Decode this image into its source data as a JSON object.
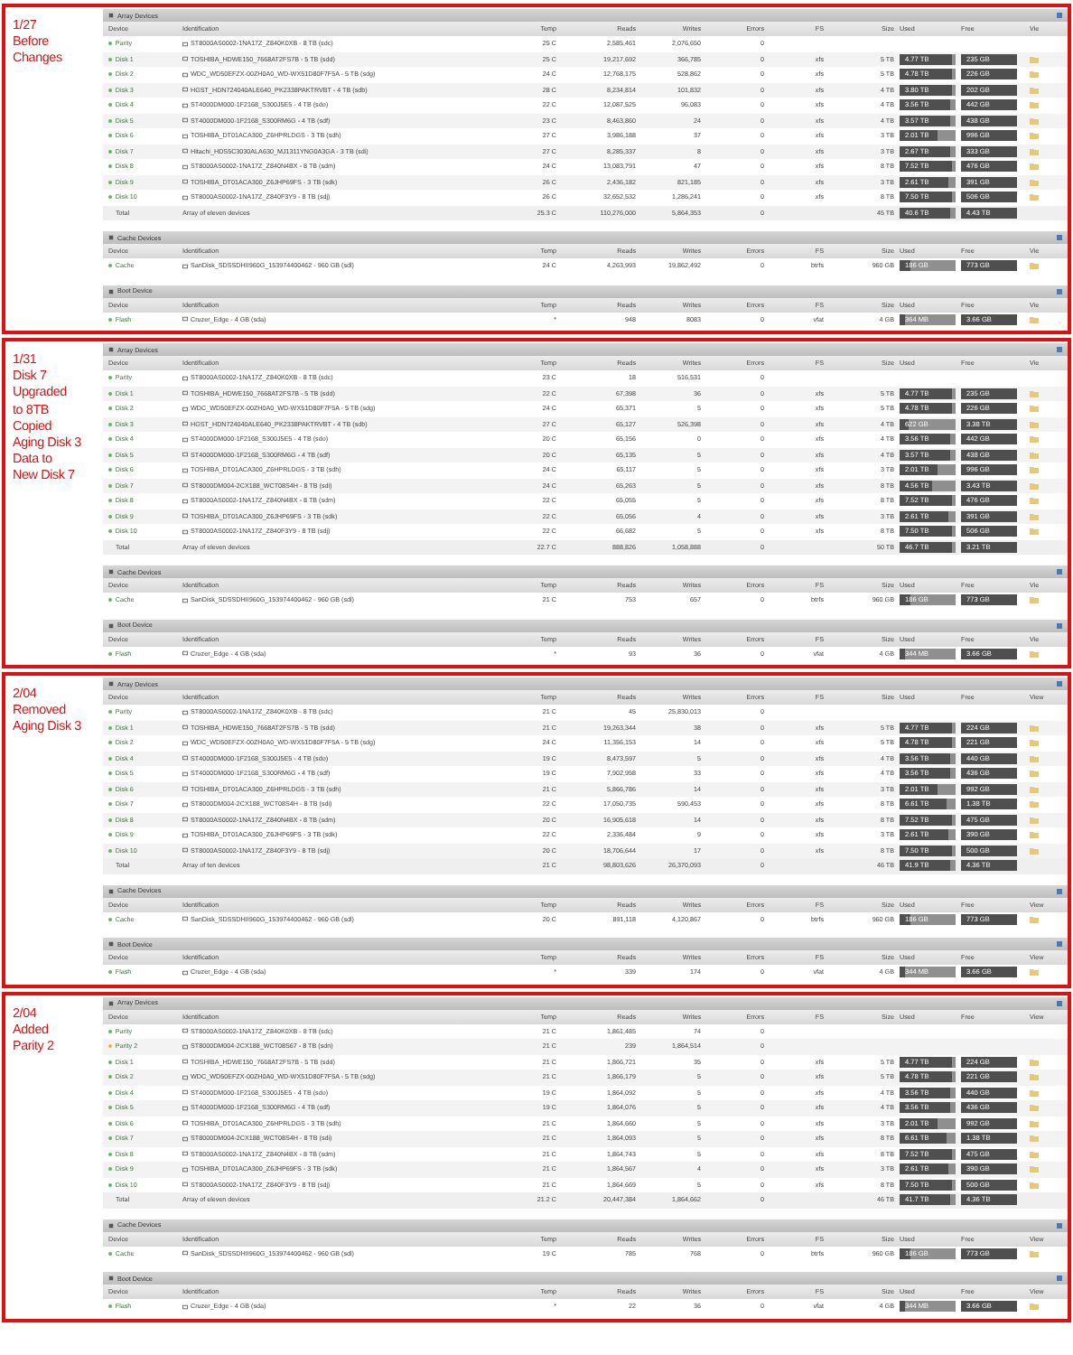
{
  "sections": [
    {
      "caption": [
        "1/27",
        "Before",
        "Changes"
      ],
      "panels": [
        {
          "title": "Array Devices",
          "columns": [
            "Device",
            "Identification",
            "Temp",
            "Reads",
            "Writes",
            "Errors",
            "FS",
            "Size",
            "Used",
            "Free",
            "Vie"
          ],
          "rows": [
            {
              "kind": "device",
              "device": "Parity",
              "color": "#5cb85c",
              "id": "ST8000AS0002-1NA17Z_Z840K0XB - 8 TB (sdc)",
              "temp": "25 C",
              "reads": "2,585,461",
              "writes": "2,076,650",
              "errors": "0"
            },
            {
              "kind": "device",
              "device": "Disk 1",
              "color": "#5cb85c",
              "id": "TOSHIBA_HDWE150_7668AT2FS7B - 5 TB (sdd)",
              "temp": "25 C",
              "reads": "19,217,692",
              "writes": "366,785",
              "errors": "0",
              "fs": "xfs",
              "size": "5 TB",
              "used": "4.77 TB",
              "free": "235 GB",
              "level": 0.95
            },
            {
              "kind": "device",
              "device": "Disk 2",
              "color": "#5cb85c",
              "id": "WDC_WD50EFZX-00ZH0A0_WD-WX51D80F7F5A - 5 TB (sdg)",
              "temp": "24 C",
              "reads": "12,768,175",
              "writes": "528,862",
              "errors": "0",
              "fs": "xfs",
              "size": "5 TB",
              "used": "4.78 TB",
              "free": "226 GB",
              "level": 0.95
            },
            {
              "kind": "device",
              "device": "Disk 3",
              "color": "#5cb85c",
              "id": "HGST_HDN724040ALE640_PK2338PAKTRVBT - 4 TB (sdb)",
              "temp": "28 C",
              "reads": "8,234,814",
              "writes": "101,832",
              "errors": "0",
              "fs": "xfs",
              "size": "4 TB",
              "used": "3.80 TB",
              "free": "202 GB",
              "level": 0.95
            },
            {
              "kind": "device",
              "device": "Disk 4",
              "color": "#5cb85c",
              "id": "ST4000DM000-1F2168_S300J5E5 - 4 TB (sdo)",
              "temp": "22 C",
              "reads": "12,087,525",
              "writes": "96,083",
              "errors": "0",
              "fs": "xfs",
              "size": "4 TB",
              "used": "3.56 TB",
              "free": "442 GB",
              "level": 0.89
            },
            {
              "kind": "device",
              "device": "Disk 5",
              "color": "#5cb85c",
              "id": "ST4000DM000-1F2168_S300RM6G - 4 TB (sdf)",
              "temp": "23 C",
              "reads": "8,463,860",
              "writes": "24",
              "errors": "0",
              "fs": "xfs",
              "size": "4 TB",
              "used": "3.57 TB",
              "free": "438 GB",
              "level": 0.89
            },
            {
              "kind": "device",
              "device": "Disk 6",
              "color": "#5cb85c",
              "id": "TOSHIBA_DT01ACA300_Z6HPRLDGS - 3 TB (sdh)",
              "temp": "27 C",
              "reads": "3,986,188",
              "writes": "37",
              "errors": "0",
              "fs": "xfs",
              "size": "3 TB",
              "used": "2.01 TB",
              "free": "996 GB",
              "level": 0.67
            },
            {
              "kind": "device",
              "device": "Disk 7",
              "color": "#5cb85c",
              "id": "Hitachi_HDS5C3030ALA630_MJ1311YNG0A3GA - 3 TB (sdi)",
              "temp": "27 C",
              "reads": "8,285,337",
              "writes": "8",
              "errors": "0",
              "fs": "xfs",
              "size": "3 TB",
              "used": "2.67 TB",
              "free": "333 GB",
              "level": 0.89
            },
            {
              "kind": "device",
              "device": "Disk 8",
              "color": "#5cb85c",
              "id": "ST8000AS0002-1NA17Z_Z840N4BX - 8 TB (sdm)",
              "temp": "24 C",
              "reads": "13,083,791",
              "writes": "47",
              "errors": "0",
              "fs": "xfs",
              "size": "8 TB",
              "used": "7.52 TB",
              "free": "476 GB",
              "level": 0.94
            },
            {
              "kind": "device",
              "device": "Disk 9",
              "color": "#5cb85c",
              "id": "TOSHIBA_DT01ACA300_Z6JHP69FS - 3 TB (sdk)",
              "temp": "26 C",
              "reads": "2,436,182",
              "writes": "821,185",
              "errors": "0",
              "fs": "xfs",
              "size": "3 TB",
              "used": "2.61 TB",
              "free": "391 GB",
              "level": 0.87
            },
            {
              "kind": "device",
              "device": "Disk 10",
              "color": "#5cb85c",
              "id": "ST8000AS0002-1NA17Z_Z840F3Y9 - 8 TB (sdj)",
              "temp": "26 C",
              "reads": "32,652,532",
              "writes": "1,286,241",
              "errors": "0",
              "fs": "xfs",
              "size": "8 TB",
              "used": "7.50 TB",
              "free": "506 GB",
              "level": 0.94
            },
            {
              "kind": "total",
              "device": "Total",
              "id": "Array of eleven devices",
              "temp": "25.3 C",
              "reads": "110,276,000",
              "writes": "5,864,353",
              "errors": "0",
              "size": "45 TB",
              "used": "40.6 TB",
              "free": "4.43 TB",
              "level": 0.9
            }
          ]
        },
        {
          "title": "Cache Devices",
          "columns": [
            "Device",
            "Identification",
            "Temp",
            "Reads",
            "Writes",
            "Errors",
            "FS",
            "Size",
            "Used",
            "Free",
            "Vie"
          ],
          "rows": [
            {
              "kind": "device",
              "device": "Cache",
              "color": "#5cb85c",
              "id": "SanDisk_SDSSDHII960G_153974400462 - 960 GB (sdl)",
              "temp": "24 C",
              "reads": "4,263,993",
              "writes": "19,862,492",
              "errors": "0",
              "fs": "btrfs",
              "size": "960 GB",
              "used": "186 GB",
              "free": "773 GB",
              "level": 0.19
            }
          ]
        },
        {
          "title": "Boot Device",
          "columns": [
            "Device",
            "Identification",
            "Temp",
            "Reads",
            "Writes",
            "Errors",
            "FS",
            "Size",
            "Used",
            "Free",
            "Vie"
          ],
          "rows": [
            {
              "kind": "device",
              "device": "Flash",
              "color": "#5cb85c",
              "id": "Cruzer_Edge - 4 GB (sda)",
              "temp": "*",
              "reads": "948",
              "writes": "8083",
              "errors": "0",
              "fs": "vfat",
              "size": "4 GB",
              "used": "364 MB",
              "free": "3.66 GB",
              "level": 0.09
            }
          ]
        }
      ]
    },
    {
      "caption": [
        "1/31",
        "Disk 7",
        "Upgraded",
        "to 8TB",
        "Copied",
        "Aging Disk 3",
        "Data to",
        "New Disk 7"
      ],
      "panels": [
        {
          "title": "Array Devices",
          "columns": [
            "Device",
            "Identification",
            "Temp",
            "Reads",
            "Writes",
            "Errors",
            "FS",
            "Size",
            "Used",
            "Free",
            "Vie"
          ],
          "rows": [
            {
              "kind": "device",
              "device": "Parity",
              "color": "#5cb85c",
              "id": "ST8000AS0002-1NA17Z_Z840K0XB - 8 TB (sdc)",
              "temp": "23 C",
              "reads": "18",
              "writes": "516,531",
              "errors": "0"
            },
            {
              "kind": "device",
              "device": "Disk 1",
              "color": "#5cb85c",
              "id": "TOSHIBA_HDWE150_7668AT2FS7B - 5 TB (sdd)",
              "temp": "22 C",
              "reads": "67,398",
              "writes": "36",
              "errors": "0",
              "fs": "xfs",
              "size": "5 TB",
              "used": "4.77 TB",
              "free": "235 GB",
              "level": 0.95
            },
            {
              "kind": "device",
              "device": "Disk 2",
              "color": "#5cb85c",
              "id": "WDC_WD50EFZX-00ZH0A0_WD-WX51D80F7F5A - 5 TB (sdg)",
              "temp": "24 C",
              "reads": "65,371",
              "writes": "5",
              "errors": "0",
              "fs": "xfs",
              "size": "5 TB",
              "used": "4.78 TB",
              "free": "226 GB",
              "level": 0.95
            },
            {
              "kind": "device",
              "device": "Disk 3",
              "color": "#5cb85c",
              "id": "HGST_HDN724040ALE640_PK2338PAKTRVBT - 4 TB (sdb)",
              "temp": "27 C",
              "reads": "65,127",
              "writes": "526,398",
              "errors": "0",
              "fs": "xfs",
              "size": "4 TB",
              "used": "622 GB",
              "free": "3.38 TB",
              "level": 0.16
            },
            {
              "kind": "device",
              "device": "Disk 4",
              "color": "#5cb85c",
              "id": "ST4000DM000-1F2168_S300J5E5 - 4 TB (sdo)",
              "temp": "20 C",
              "reads": "65,156",
              "writes": "0",
              "errors": "0",
              "fs": "xfs",
              "size": "4 TB",
              "used": "3.56 TB",
              "free": "442 GB",
              "level": 0.89
            },
            {
              "kind": "device",
              "device": "Disk 5",
              "color": "#5cb85c",
              "id": "ST4000DM000-1F2168_S300RM6G - 4 TB (sdf)",
              "temp": "20 C",
              "reads": "65,135",
              "writes": "5",
              "errors": "0",
              "fs": "xfs",
              "size": "4 TB",
              "used": "3.57 TB",
              "free": "438 GB",
              "level": 0.89
            },
            {
              "kind": "device",
              "device": "Disk 6",
              "color": "#5cb85c",
              "id": "TOSHIBA_DT01ACA300_Z6HPRLDGS - 3 TB (sdh)",
              "temp": "24 C",
              "reads": "65,117",
              "writes": "5",
              "errors": "0",
              "fs": "xfs",
              "size": "3 TB",
              "used": "2.01 TB",
              "free": "996 GB",
              "level": 0.67
            },
            {
              "kind": "device",
              "device": "Disk 7",
              "color": "#5cb85c",
              "id": "ST8000DM004-2CX188_WCT08S4H - 8 TB (sdi)",
              "temp": "24 C",
              "reads": "65,263",
              "writes": "5",
              "errors": "0",
              "fs": "xfs",
              "size": "8 TB",
              "used": "4.56 TB",
              "free": "3.43 TB",
              "level": 0.57
            },
            {
              "kind": "device",
              "device": "Disk 8",
              "color": "#5cb85c",
              "id": "ST8000AS0002-1NA17Z_Z840N4BX - 8 TB (sdm)",
              "temp": "22 C",
              "reads": "65,055",
              "writes": "5",
              "errors": "0",
              "fs": "xfs",
              "size": "8 TB",
              "used": "7.52 TB",
              "free": "476 GB",
              "level": 0.94
            },
            {
              "kind": "device",
              "device": "Disk 9",
              "color": "#5cb85c",
              "id": "TOSHIBA_DT01ACA300_Z6JHP69FS - 3 TB (sdk)",
              "temp": "22 C",
              "reads": "65,056",
              "writes": "4",
              "errors": "0",
              "fs": "xfs",
              "size": "3 TB",
              "used": "2.61 TB",
              "free": "391 GB",
              "level": 0.87
            },
            {
              "kind": "device",
              "device": "Disk 10",
              "color": "#5cb85c",
              "id": "ST8000AS0002-1NA17Z_Z840F3Y9 - 8 TB (sdj)",
              "temp": "22 C",
              "reads": "66,682",
              "writes": "5",
              "errors": "0",
              "fs": "xfs",
              "size": "8 TB",
              "used": "7.50 TB",
              "free": "506 GB",
              "level": 0.94
            },
            {
              "kind": "total",
              "device": "Total",
              "id": "Array of eleven devices",
              "temp": "22.7 C",
              "reads": "888,826",
              "writes": "1,058,888",
              "errors": "0",
              "size": "50 TB",
              "used": "46.7 TB",
              "free": "3.21 TB",
              "level": 0.93
            }
          ]
        },
        {
          "title": "Cache Devices",
          "columns": [
            "Device",
            "Identification",
            "Temp",
            "Reads",
            "Writes",
            "Errors",
            "FS",
            "Size",
            "Used",
            "Free",
            "Vie"
          ],
          "rows": [
            {
              "kind": "device",
              "device": "Cache",
              "color": "#5cb85c",
              "id": "SanDisk_SDSSDHII960G_153974400462 - 960 GB (sdl)",
              "temp": "21 C",
              "reads": "753",
              "writes": "657",
              "errors": "0",
              "fs": "btrfs",
              "size": "960 GB",
              "used": "186 GB",
              "free": "773 GB",
              "level": 0.19
            }
          ]
        },
        {
          "title": "Boot Device",
          "columns": [
            "Device",
            "Identification",
            "Temp",
            "Reads",
            "Writes",
            "Errors",
            "FS",
            "Size",
            "Used",
            "Free",
            "Vie"
          ],
          "rows": [
            {
              "kind": "device",
              "device": "Flash",
              "color": "#5cb85c",
              "id": "Cruzer_Edge - 4 GB (sda)",
              "temp": "*",
              "reads": "93",
              "writes": "36",
              "errors": "0",
              "fs": "vfat",
              "size": "4 GB",
              "used": "344 MB",
              "free": "3.66 GB",
              "level": 0.09
            }
          ]
        }
      ]
    },
    {
      "caption": [
        "2/04",
        "Removed",
        "Aging Disk 3"
      ],
      "panels": [
        {
          "title": "Array Devices",
          "columns": [
            "Device",
            "Identification",
            "Temp",
            "Reads",
            "Writes",
            "Errors",
            "FS",
            "Size",
            "Used",
            "Free",
            "View"
          ],
          "rows": [
            {
              "kind": "device",
              "device": "Parity",
              "color": "#5cb85c",
              "id": "ST8000AS0002-1NA17Z_Z840K0XB - 8 TB (sdc)",
              "temp": "21 C",
              "reads": "45",
              "writes": "25,830,013",
              "errors": "0"
            },
            {
              "kind": "device",
              "device": "Disk 1",
              "color": "#5cb85c",
              "id": "TOSHIBA_HDWE150_7668AT2FS7B - 5 TB (sdd)",
              "temp": "21 C",
              "reads": "19,263,344",
              "writes": "38",
              "errors": "0",
              "fs": "xfs",
              "size": "5 TB",
              "used": "4.77 TB",
              "free": "224 GB",
              "level": 0.95
            },
            {
              "kind": "device",
              "device": "Disk 2",
              "color": "#5cb85c",
              "id": "WDC_WD50EFZX-00ZH0A0_WD-WX51D80F7F5A - 5 TB (sdg)",
              "temp": "24 C",
              "reads": "11,356,153",
              "writes": "14",
              "errors": "0",
              "fs": "xfs",
              "size": "5 TB",
              "used": "4.78 TB",
              "free": "221 GB",
              "level": 0.95
            },
            {
              "kind": "device",
              "device": "Disk 4",
              "color": "#5cb85c",
              "id": "ST4000DM000-1F2168_S300J5E5 - 4 TB (sdo)",
              "temp": "19 C",
              "reads": "8,473,597",
              "writes": "5",
              "errors": "0",
              "fs": "xfs",
              "size": "4 TB",
              "used": "3.56 TB",
              "free": "440 GB",
              "level": 0.89
            },
            {
              "kind": "device",
              "device": "Disk 5",
              "color": "#5cb85c",
              "id": "ST4000DM000-1F2168_S300RM6G - 4 TB (sdf)",
              "temp": "19 C",
              "reads": "7,902,958",
              "writes": "33",
              "errors": "0",
              "fs": "xfs",
              "size": "4 TB",
              "used": "3.56 TB",
              "free": "436 GB",
              "level": 0.89
            },
            {
              "kind": "device",
              "device": "Disk 6",
              "color": "#5cb85c",
              "id": "TOSHIBA_DT01ACA300_Z6HPRLDGS - 3 TB (sdh)",
              "temp": "21 C",
              "reads": "5,866,786",
              "writes": "14",
              "errors": "0",
              "fs": "xfs",
              "size": "3 TB",
              "used": "2.01 TB",
              "free": "992 GB",
              "level": 0.67
            },
            {
              "kind": "device",
              "device": "Disk 7",
              "color": "#5cb85c",
              "id": "ST8000DM004-2CX188_WCT08S4H - 8 TB (sdi)",
              "temp": "22 C",
              "reads": "17,050,735",
              "writes": "590,453",
              "errors": "0",
              "fs": "xfs",
              "size": "8 TB",
              "used": "6.61 TB",
              "free": "1.38 TB",
              "level": 0.83
            },
            {
              "kind": "device",
              "device": "Disk 8",
              "color": "#5cb85c",
              "id": "ST8000AS0002-1NA17Z_Z840N4BX - 8 TB (sdm)",
              "temp": "20 C",
              "reads": "16,905,618",
              "writes": "14",
              "errors": "0",
              "fs": "xfs",
              "size": "8 TB",
              "used": "7.52 TB",
              "free": "475 GB",
              "level": 0.94
            },
            {
              "kind": "device",
              "device": "Disk 9",
              "color": "#5cb85c",
              "id": "TOSHIBA_DT01ACA300_Z6JHP69FS - 3 TB (sdk)",
              "temp": "22 C",
              "reads": "2,336,484",
              "writes": "9",
              "errors": "0",
              "fs": "xfs",
              "size": "3 TB",
              "used": "2.61 TB",
              "free": "390 GB",
              "level": 0.87
            },
            {
              "kind": "device",
              "device": "Disk 10",
              "color": "#5cb85c",
              "id": "ST8000AS0002-1NA17Z_Z840F3Y9 - 8 TB (sdj)",
              "temp": "20 C",
              "reads": "18,706,644",
              "writes": "17",
              "errors": "0",
              "fs": "xfs",
              "size": "8 TB",
              "used": "7.50 TB",
              "free": "500 GB",
              "level": 0.94
            },
            {
              "kind": "total",
              "device": "Total",
              "id": "Array of ten devices",
              "temp": "21 C",
              "reads": "98,803,626",
              "writes": "26,370,093",
              "errors": "0",
              "size": "46 TB",
              "used": "41.9 TB",
              "free": "4.36 TB",
              "level": 0.91
            }
          ]
        },
        {
          "title": "Cache Devices",
          "columns": [
            "Device",
            "Identification",
            "Temp",
            "Reads",
            "Writes",
            "Errors",
            "FS",
            "Size",
            "Used",
            "Free",
            "View"
          ],
          "rows": [
            {
              "kind": "device",
              "device": "Cache",
              "color": "#5cb85c",
              "id": "SanDisk_SDSSDHII960G_153974400462 - 960 GB (sdl)",
              "temp": "20 C",
              "reads": "891,118",
              "writes": "4,120,867",
              "errors": "0",
              "fs": "btrfs",
              "size": "960 GB",
              "used": "186 GB",
              "free": "773 GB",
              "level": 0.19
            }
          ]
        },
        {
          "title": "Boot Device",
          "columns": [
            "Device",
            "Identification",
            "Temp",
            "Reads",
            "Writes",
            "Errors",
            "FS",
            "Size",
            "Used",
            "Free",
            "View"
          ],
          "rows": [
            {
              "kind": "device",
              "device": "Flash",
              "color": "#5cb85c",
              "id": "Cruzer_Edge - 4 GB (sda)",
              "temp": "*",
              "reads": "339",
              "writes": "174",
              "errors": "0",
              "fs": "vfat",
              "size": "4 GB",
              "used": "344 MB",
              "free": "3.66 GB",
              "level": 0.09
            }
          ]
        }
      ]
    },
    {
      "caption": [
        "2/04",
        "Added",
        "Parity 2"
      ],
      "panels": [
        {
          "title": "Array Devices",
          "columns": [
            "Device",
            "Identification",
            "Temp",
            "Reads",
            "Writes",
            "Errors",
            "FS",
            "Size",
            "Used",
            "Free",
            "View"
          ],
          "rows": [
            {
              "kind": "device",
              "device": "Parity",
              "color": "#5cb85c",
              "id": "ST8000AS0002-1NA17Z_Z840K0XB - 8 TB (sdc)",
              "temp": "21 C",
              "reads": "1,861,485",
              "writes": "74",
              "errors": "0"
            },
            {
              "kind": "device",
              "device": "Parity 2",
              "color": "#f0ad4e",
              "id": "ST8000DM004-2CX188_WCT08S67 - 8 TB (sdn)",
              "temp": "21 C",
              "reads": "239",
              "writes": "1,864,514",
              "errors": "0"
            },
            {
              "kind": "device",
              "device": "Disk 1",
              "color": "#5cb85c",
              "id": "TOSHIBA_HDWE150_7668AT2FS7B - 5 TB (sdd)",
              "temp": "21 C",
              "reads": "1,866,721",
              "writes": "35",
              "errors": "0",
              "fs": "xfs",
              "size": "5 TB",
              "used": "4.77 TB",
              "free": "224 GB",
              "level": 0.95
            },
            {
              "kind": "device",
              "device": "Disk 2",
              "color": "#5cb85c",
              "id": "WDC_WD50EFZX-00ZH0A0_WD-WX51D80F7F5A - 5 TB (sdg)",
              "temp": "21 C",
              "reads": "1,866,179",
              "writes": "5",
              "errors": "0",
              "fs": "xfs",
              "size": "5 TB",
              "used": "4.78 TB",
              "free": "221 GB",
              "level": 0.95
            },
            {
              "kind": "device",
              "device": "Disk 4",
              "color": "#5cb85c",
              "id": "ST4000DM000-1F2168_S300J5E5 - 4 TB (sdo)",
              "temp": "19 C",
              "reads": "1,864,092",
              "writes": "5",
              "errors": "0",
              "fs": "xfs",
              "size": "4 TB",
              "used": "3.56 TB",
              "free": "440 GB",
              "level": 0.89
            },
            {
              "kind": "device",
              "device": "Disk 5",
              "color": "#5cb85c",
              "id": "ST4000DM000-1F2168_S300RM6G - 4 TB (sdf)",
              "temp": "19 C",
              "reads": "1,864,076",
              "writes": "5",
              "errors": "0",
              "fs": "xfs",
              "size": "4 TB",
              "used": "3.56 TB",
              "free": "436 GB",
              "level": 0.89
            },
            {
              "kind": "device",
              "device": "Disk 6",
              "color": "#5cb85c",
              "id": "TOSHIBA_DT01ACA300_Z6HPRLDGS - 3 TB (sdh)",
              "temp": "21 C",
              "reads": "1,864,660",
              "writes": "5",
              "errors": "0",
              "fs": "xfs",
              "size": "3 TB",
              "used": "2.01 TB",
              "free": "992 GB",
              "level": 0.67
            },
            {
              "kind": "device",
              "device": "Disk 7",
              "color": "#5cb85c",
              "id": "ST8000DM004-2CX188_WCT08S4H - 8 TB (sdi)",
              "temp": "21 C",
              "reads": "1,864,093",
              "writes": "5",
              "errors": "0",
              "fs": "xfs",
              "size": "8 TB",
              "used": "6.61 TB",
              "free": "1.38 TB",
              "level": 0.83
            },
            {
              "kind": "device",
              "device": "Disk 8",
              "color": "#5cb85c",
              "id": "ST8000AS0002-1NA17Z_Z840N4BX - 8 TB (sdm)",
              "temp": "21 C",
              "reads": "1,864,743",
              "writes": "5",
              "errors": "0",
              "fs": "xfs",
              "size": "8 TB",
              "used": "7.52 TB",
              "free": "475 GB",
              "level": 0.94
            },
            {
              "kind": "device",
              "device": "Disk 9",
              "color": "#5cb85c",
              "id": "TOSHIBA_DT01ACA300_Z6JHP69FS - 3 TB (sdk)",
              "temp": "21 C",
              "reads": "1,864,567",
              "writes": "4",
              "errors": "0",
              "fs": "xfs",
              "size": "3 TB",
              "used": "2.61 TB",
              "free": "390 GB",
              "level": 0.87
            },
            {
              "kind": "device",
              "device": "Disk 10",
              "color": "#5cb85c",
              "id": "ST8000AS0002-1NA17Z_Z840F3Y9 - 8 TB (sdj)",
              "temp": "21 C",
              "reads": "1,864,669",
              "writes": "5",
              "errors": "0",
              "fs": "xfs",
              "size": "8 TB",
              "used": "7.50 TB",
              "free": "500 GB",
              "level": 0.94
            },
            {
              "kind": "total",
              "device": "Total",
              "id": "Array of eleven devices",
              "temp": "21.2 C",
              "reads": "20,447,384",
              "writes": "1,864,662",
              "errors": "0",
              "size": "46 TB",
              "used": "41.7 TB",
              "free": "4.36 TB",
              "level": 0.91
            }
          ]
        },
        {
          "title": "Cache Devices",
          "columns": [
            "Device",
            "Identification",
            "Temp",
            "Reads",
            "Writes",
            "Errors",
            "FS",
            "Size",
            "Used",
            "Free",
            "View"
          ],
          "rows": [
            {
              "kind": "device",
              "device": "Cache",
              "color": "#5cb85c",
              "id": "SanDisk_SDSSDHII960G_153974400462 - 960 GB (sdl)",
              "temp": "19 C",
              "reads": "785",
              "writes": "768",
              "errors": "0",
              "fs": "btrfs",
              "size": "960 GB",
              "used": "186 GB",
              "free": "773 GB",
              "level": 0.19
            }
          ]
        },
        {
          "title": "Boot Device",
          "columns": [
            "Device",
            "Identification",
            "Temp",
            "Reads",
            "Writes",
            "Errors",
            "FS",
            "Size",
            "Used",
            "Free",
            "View"
          ],
          "rows": [
            {
              "kind": "device",
              "device": "Flash",
              "color": "#5cb85c",
              "id": "Cruzer_Edge - 4 GB (sda)",
              "temp": "*",
              "reads": "22",
              "writes": "36",
              "errors": "0",
              "fs": "vfat",
              "size": "4 GB",
              "used": "344 MB",
              "free": "3.66 GB",
              "level": 0.09
            }
          ]
        }
      ]
    }
  ]
}
